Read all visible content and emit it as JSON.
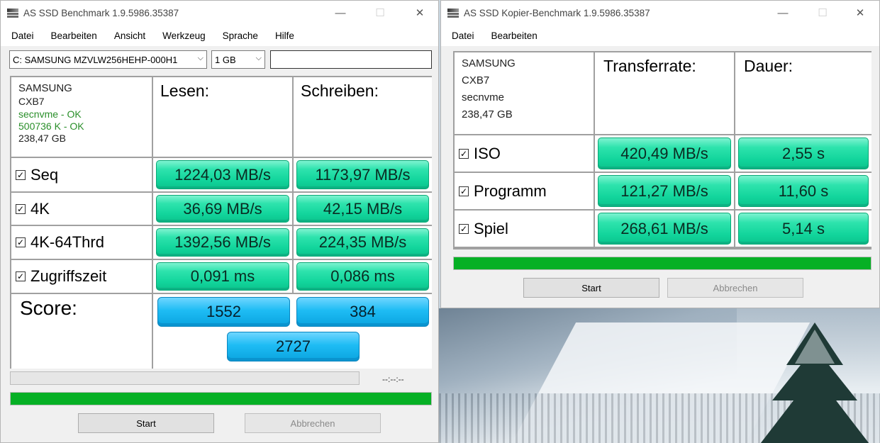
{
  "left_window": {
    "title": "AS SSD Benchmark 1.9.5986.35387",
    "menu": [
      "Datei",
      "Bearbeiten",
      "Ansicht",
      "Werkzeug",
      "Sprache",
      "Hilfe"
    ],
    "drive_select": "C: SAMSUNG MZVLW256HEHP-000H1",
    "size_select": "1 GB",
    "search_value": "",
    "info": {
      "vendor": "SAMSUNG",
      "firmware": "CXB7",
      "driver": "secnvme - OK",
      "align": "500736 K - OK",
      "capacity": "238,47 GB"
    },
    "headers": {
      "read": "Lesen:",
      "write": "Schreiben:"
    },
    "rows": [
      {
        "label": "Seq",
        "read": "1224,03 MB/s",
        "write": "1173,97 MB/s"
      },
      {
        "label": "4K",
        "read": "36,69 MB/s",
        "write": "42,15 MB/s"
      },
      {
        "label": "4K-64Thrd",
        "read": "1392,56 MB/s",
        "write": "224,35 MB/s"
      },
      {
        "label": "Zugriffszeit",
        "read": "0,091 ms",
        "write": "0,086 ms"
      }
    ],
    "score_label": "Score:",
    "score_read": "1552",
    "score_write": "384",
    "score_total": "2727",
    "time_display": "--:--:--",
    "progress_percent": 100,
    "start_label": "Start",
    "abort_label": "Abbrechen"
  },
  "right_window": {
    "title": "AS SSD Kopier-Benchmark 1.9.5986.35387",
    "menu": [
      "Datei",
      "Bearbeiten"
    ],
    "info": {
      "vendor": "SAMSUNG",
      "firmware": "CXB7",
      "driver": "secnvme",
      "capacity": "238,47 GB"
    },
    "headers": {
      "rate": "Transferrate:",
      "duration": "Dauer:"
    },
    "rows": [
      {
        "label": "ISO",
        "rate": "420,49 MB/s",
        "duration": "2,55 s"
      },
      {
        "label": "Programm",
        "rate": "121,27 MB/s",
        "duration": "11,60 s"
      },
      {
        "label": "Spiel",
        "rate": "268,61 MB/s",
        "duration": "5,14 s"
      }
    ],
    "progress_percent": 100,
    "start_label": "Start",
    "abort_label": "Abbrechen"
  },
  "window_controls": {
    "minimize": "—",
    "maximize": "☐",
    "close": "✕"
  },
  "colors": {
    "result_green": "#12d59c",
    "score_blue": "#1ebcf4",
    "progress_green": "#06b025"
  },
  "icons": [
    "app-icon",
    "checkbox-checked-icon",
    "dropdown-arrow-icon"
  ]
}
